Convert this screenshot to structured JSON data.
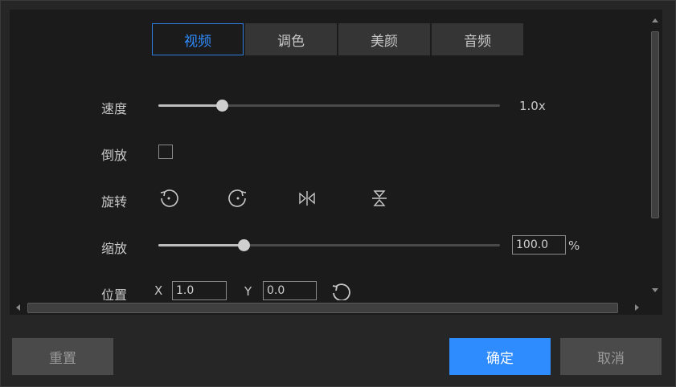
{
  "tabs": [
    {
      "label": "视频",
      "active": true
    },
    {
      "label": "调色",
      "active": false
    },
    {
      "label": "美颜",
      "active": false
    },
    {
      "label": "音频",
      "active": false
    }
  ],
  "speed": {
    "label": "速度",
    "value_text": "1.0x",
    "slider_fraction": 0.185
  },
  "reverse": {
    "label": "倒放",
    "checked": false
  },
  "rotate": {
    "label": "旋转",
    "icons": [
      "rotate-counterclockwise-icon",
      "rotate-clockwise-icon",
      "flip-horizontal-icon",
      "flip-vertical-icon"
    ]
  },
  "scale": {
    "label": "缩放",
    "value": "100.0",
    "unit": "%",
    "slider_fraction": 0.25
  },
  "position": {
    "label": "位置",
    "x_label": "X",
    "x_value": "1.0",
    "y_label": "Y",
    "y_value": "0.0",
    "reset_icon": "reset-position-icon"
  },
  "footer": {
    "reset_label": "重置",
    "ok_label": "确定",
    "cancel_label": "取消"
  },
  "colors": {
    "accent": "#2f8cff",
    "panel": "#1b1b1b",
    "background": "#262626",
    "button_gray": "#4a4a4a"
  }
}
